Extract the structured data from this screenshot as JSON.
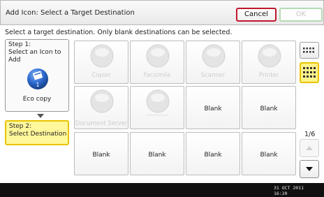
{
  "window": {
    "title": "Add Icon: Select a Target Destination",
    "cancel_label": "Cancel",
    "ok_label": "OK"
  },
  "instruction": "Select a target destination. Only blank destinations can be selected.",
  "step1": {
    "title": "Step 1:",
    "desc": "Select an Icon to Add",
    "icon_name": "eco-copy-icon",
    "icon_badge": "1",
    "label": "Eco copy"
  },
  "step2": {
    "title": "Step 2:",
    "desc": "Select Destination"
  },
  "grid": {
    "tiles": [
      {
        "label": "Copier",
        "state": "disabled",
        "icon": "copier-icon"
      },
      {
        "label": "Facsimile",
        "state": "disabled",
        "icon": "facsimile-icon"
      },
      {
        "label": "Scanner",
        "state": "disabled",
        "icon": "scanner-icon"
      },
      {
        "label": "Printer",
        "state": "disabled",
        "icon": "printer-icon"
      },
      {
        "label": "Document Server",
        "state": "disabled",
        "icon": "document-server-icon"
      },
      {
        "label": "----------",
        "state": "disabled",
        "icon": "generic-app-icon"
      },
      {
        "label": "Blank",
        "state": "blank"
      },
      {
        "label": "Blank",
        "state": "blank"
      },
      {
        "label": "Blank",
        "state": "blank"
      },
      {
        "label": "Blank",
        "state": "blank"
      },
      {
        "label": "Blank",
        "state": "blank"
      },
      {
        "label": "Blank",
        "state": "blank"
      }
    ]
  },
  "view": {
    "small_icon": "small-grid-view-icon",
    "large_icon": "large-grid-view-icon",
    "selected": "large"
  },
  "pager": {
    "page": "1/6",
    "up_icon": "triangle-up-icon",
    "down_icon": "triangle-down-icon"
  },
  "status": {
    "date": "31 OCT  2011",
    "time": "16:20"
  },
  "colors": {
    "cancel_border": "#c0182f",
    "ok_border": "#b7dbb4",
    "highlight_fill": "#fff79a",
    "highlight_border": "#e8c400",
    "icon_blue": "#2a66c9"
  }
}
